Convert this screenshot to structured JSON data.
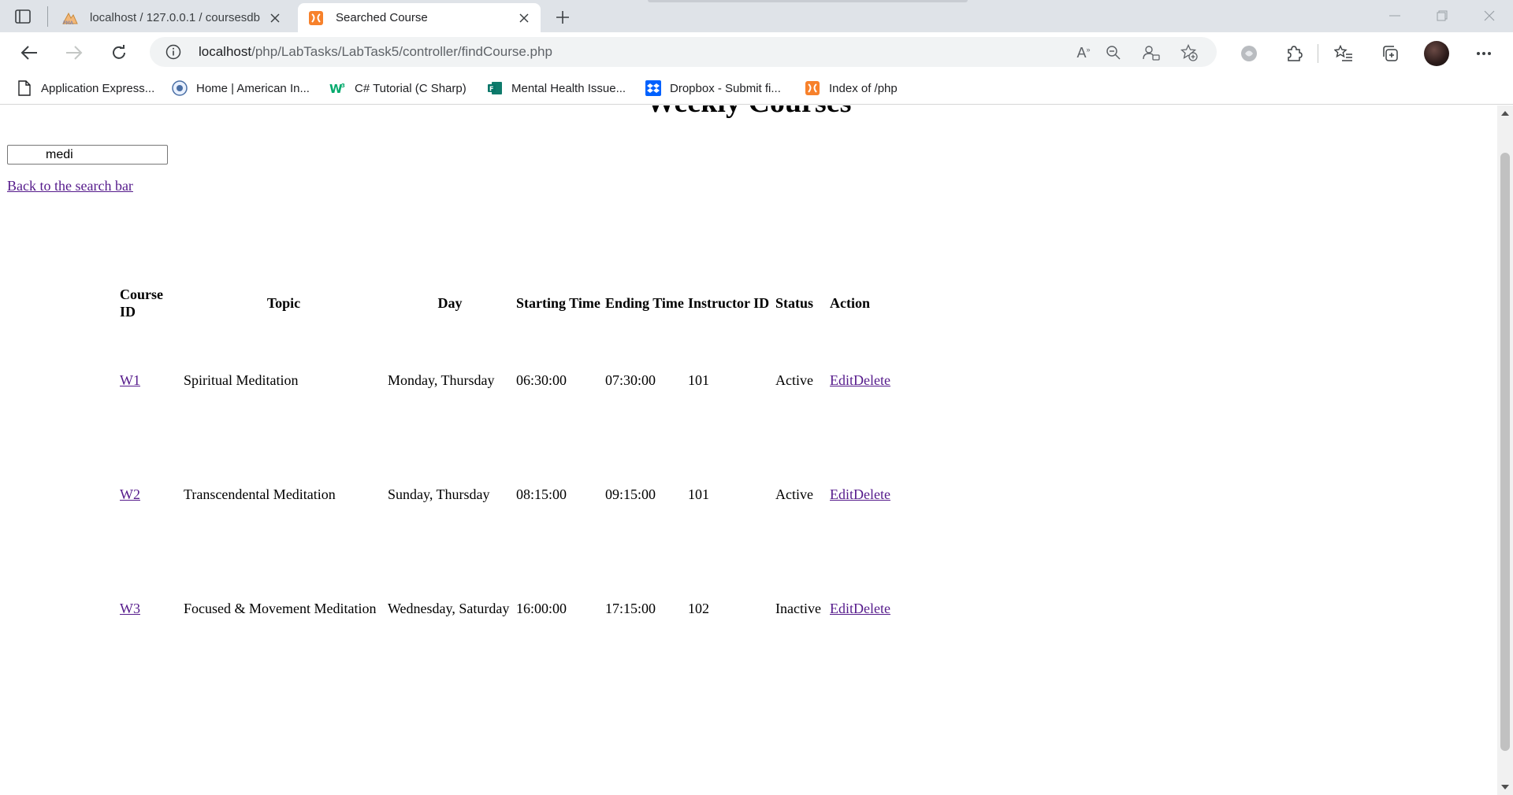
{
  "browser": {
    "tabs": [
      {
        "title": "localhost / 127.0.0.1 / coursesdb",
        "active": false
      },
      {
        "title": "Searched Course",
        "active": true
      }
    ],
    "url_host": "localhost",
    "url_path": "/php/LabTasks/LabTask5/controller/findCourse.php",
    "bookmarks": [
      {
        "label": "Application Express...",
        "icon": "page-icon"
      },
      {
        "label": "Home | American In...",
        "icon": "globe-icon"
      },
      {
        "label": "C# Tutorial (C Sharp)",
        "icon": "w3schools-icon"
      },
      {
        "label": "Mental Health Issue...",
        "icon": "forms-icon"
      },
      {
        "label": "Dropbox - Submit fi...",
        "icon": "dropbox-icon"
      },
      {
        "label": "Index of /php",
        "icon": "xampp-icon"
      }
    ]
  },
  "page": {
    "title": "Weekly Courses",
    "search_value": "medi",
    "back_link": "Back to the search bar",
    "table": {
      "headers": {
        "course_id": "Course ID",
        "topic": "Topic",
        "day": "Day",
        "start": "Starting Time",
        "end": "Ending Time",
        "instructor": "Instructor ID",
        "status": "Status",
        "action": "Action"
      },
      "rows": [
        {
          "course_id": "W1",
          "topic": "Spiritual Meditation",
          "day": "Monday, Thursday",
          "start": "06:30:00",
          "end": "07:30:00",
          "instructor": "101",
          "status": "Active",
          "edit": "Edit",
          "delete": "Delete"
        },
        {
          "course_id": "W2",
          "topic": "Transcendental Meditation",
          "day": "Sunday, Thursday",
          "start": "08:15:00",
          "end": "09:15:00",
          "instructor": "101",
          "status": "Active",
          "edit": "Edit",
          "delete": "Delete"
        },
        {
          "course_id": "W3",
          "topic": "Focused & Movement Meditation",
          "day": "Wednesday, Saturday",
          "start": "16:00:00",
          "end": "17:15:00",
          "instructor": "102",
          "status": "Inactive",
          "edit": "Edit",
          "delete": "Delete"
        }
      ]
    }
  },
  "colors": {
    "tabstrip": "#dfe3e8",
    "visited_link": "#551a8b",
    "xampp_orange": "#f7812b"
  }
}
